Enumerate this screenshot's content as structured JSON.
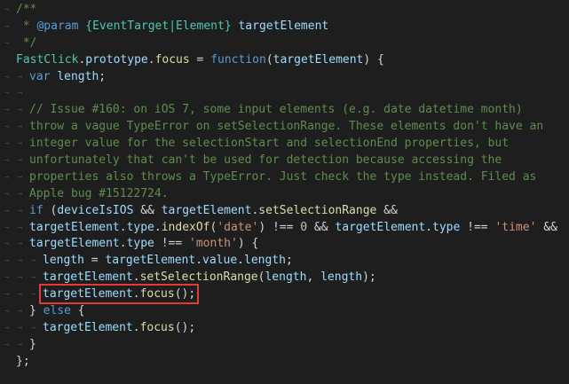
{
  "editor": {
    "background": "#1e1e1e",
    "highlight_color": "#e53935",
    "lines": [
      {
        "indent": 0,
        "tokens": [
          {
            "c": "cmt",
            "t": "/**"
          }
        ]
      },
      {
        "indent": 0,
        "tokens": [
          {
            "c": "cmt",
            "t": " * "
          },
          {
            "c": "tag",
            "t": "@param"
          },
          {
            "c": "pn",
            "t": " "
          },
          {
            "c": "type",
            "t": "{EventTarget|Element}"
          },
          {
            "c": "pn",
            "t": " "
          },
          {
            "c": "id",
            "t": "targetElement"
          }
        ]
      },
      {
        "indent": 0,
        "tokens": [
          {
            "c": "cmt",
            "t": " */"
          }
        ]
      },
      {
        "indent": 0,
        "tokens": [
          {
            "c": "cls",
            "t": "FastClick"
          },
          {
            "c": "pn",
            "t": "."
          },
          {
            "c": "id",
            "t": "prototype"
          },
          {
            "c": "pn",
            "t": "."
          },
          {
            "c": "fn",
            "t": "focus"
          },
          {
            "c": "pn",
            "t": " = "
          },
          {
            "c": "kw",
            "t": "function"
          },
          {
            "c": "pn",
            "t": "("
          },
          {
            "c": "id",
            "t": "targetElement"
          },
          {
            "c": "pn",
            "t": ") {"
          }
        ]
      },
      {
        "indent": 1,
        "tokens": [
          {
            "c": "kw",
            "t": "var"
          },
          {
            "c": "pn",
            "t": " "
          },
          {
            "c": "id",
            "t": "length"
          },
          {
            "c": "pn",
            "t": ";"
          }
        ]
      },
      {
        "indent": 1,
        "tokens": []
      },
      {
        "indent": 1,
        "tokens": [
          {
            "c": "cmt",
            "t": "// Issue #160: on iOS 7, some input elements (e.g. date datetime month)"
          }
        ]
      },
      {
        "indent": 1,
        "tokens": [
          {
            "c": "cmt",
            "t": "throw a vague TypeError on setSelectionRange. These elements don't have an"
          }
        ]
      },
      {
        "indent": 1,
        "tokens": [
          {
            "c": "cmt",
            "t": "integer value for the selectionStart and selectionEnd properties, but"
          }
        ]
      },
      {
        "indent": 1,
        "tokens": [
          {
            "c": "cmt",
            "t": "unfortunately that can't be used for detection because accessing the"
          }
        ]
      },
      {
        "indent": 1,
        "tokens": [
          {
            "c": "cmt",
            "t": "properties also throws a TypeError. Just check the type instead. Filed as"
          }
        ]
      },
      {
        "indent": 1,
        "tokens": [
          {
            "c": "cmt",
            "t": "Apple bug #15122724."
          }
        ]
      },
      {
        "indent": 1,
        "tokens": [
          {
            "c": "kw",
            "t": "if"
          },
          {
            "c": "pn",
            "t": " ("
          },
          {
            "c": "id",
            "t": "deviceIsIOS"
          },
          {
            "c": "pn",
            "t": " && "
          },
          {
            "c": "id",
            "t": "targetElement"
          },
          {
            "c": "pn",
            "t": "."
          },
          {
            "c": "fn",
            "t": "setSelectionRange"
          },
          {
            "c": "pn",
            "t": " &&"
          }
        ]
      },
      {
        "indent": 1,
        "tokens": [
          {
            "c": "id",
            "t": "targetElement"
          },
          {
            "c": "pn",
            "t": "."
          },
          {
            "c": "id",
            "t": "type"
          },
          {
            "c": "pn",
            "t": "."
          },
          {
            "c": "fn",
            "t": "indexOf"
          },
          {
            "c": "pn",
            "t": "("
          },
          {
            "c": "str",
            "t": "'date'"
          },
          {
            "c": "pn",
            "t": ") !== "
          },
          {
            "c": "num",
            "t": "0"
          },
          {
            "c": "pn",
            "t": " && "
          },
          {
            "c": "id",
            "t": "targetElement"
          },
          {
            "c": "pn",
            "t": "."
          },
          {
            "c": "id",
            "t": "type"
          },
          {
            "c": "pn",
            "t": " !== "
          },
          {
            "c": "str",
            "t": "'time'"
          },
          {
            "c": "pn",
            "t": " &&"
          }
        ]
      },
      {
        "indent": 1,
        "tokens": [
          {
            "c": "id",
            "t": "targetElement"
          },
          {
            "c": "pn",
            "t": "."
          },
          {
            "c": "id",
            "t": "type"
          },
          {
            "c": "pn",
            "t": " !== "
          },
          {
            "c": "str",
            "t": "'month'"
          },
          {
            "c": "pn",
            "t": ") {"
          }
        ]
      },
      {
        "indent": 2,
        "tokens": [
          {
            "c": "id",
            "t": "length"
          },
          {
            "c": "pn",
            "t": " = "
          },
          {
            "c": "id",
            "t": "targetElement"
          },
          {
            "c": "pn",
            "t": "."
          },
          {
            "c": "id",
            "t": "value"
          },
          {
            "c": "pn",
            "t": "."
          },
          {
            "c": "id",
            "t": "length"
          },
          {
            "c": "pn",
            "t": ";"
          }
        ]
      },
      {
        "indent": 2,
        "tokens": [
          {
            "c": "id",
            "t": "targetElement"
          },
          {
            "c": "pn",
            "t": "."
          },
          {
            "c": "fn",
            "t": "setSelectionRange"
          },
          {
            "c": "pn",
            "t": "("
          },
          {
            "c": "id",
            "t": "length"
          },
          {
            "c": "pn",
            "t": ", "
          },
          {
            "c": "id",
            "t": "length"
          },
          {
            "c": "pn",
            "t": ");"
          }
        ]
      },
      {
        "indent": 2,
        "highlight": true,
        "tokens": [
          {
            "c": "id",
            "t": "targetElement"
          },
          {
            "c": "pn",
            "t": "."
          },
          {
            "c": "fn",
            "t": "focus"
          },
          {
            "c": "pn",
            "t": "();"
          }
        ]
      },
      {
        "indent": 1,
        "tokens": [
          {
            "c": "pn",
            "t": "} "
          },
          {
            "c": "kw",
            "t": "else"
          },
          {
            "c": "pn",
            "t": " {"
          }
        ]
      },
      {
        "indent": 2,
        "tokens": [
          {
            "c": "id",
            "t": "targetElement"
          },
          {
            "c": "pn",
            "t": "."
          },
          {
            "c": "fn",
            "t": "focus"
          },
          {
            "c": "pn",
            "t": "();"
          }
        ]
      },
      {
        "indent": 1,
        "tokens": [
          {
            "c": "pn",
            "t": "}"
          }
        ]
      },
      {
        "indent": 0,
        "tokens": [
          {
            "c": "pn",
            "t": "};"
          }
        ]
      }
    ]
  }
}
